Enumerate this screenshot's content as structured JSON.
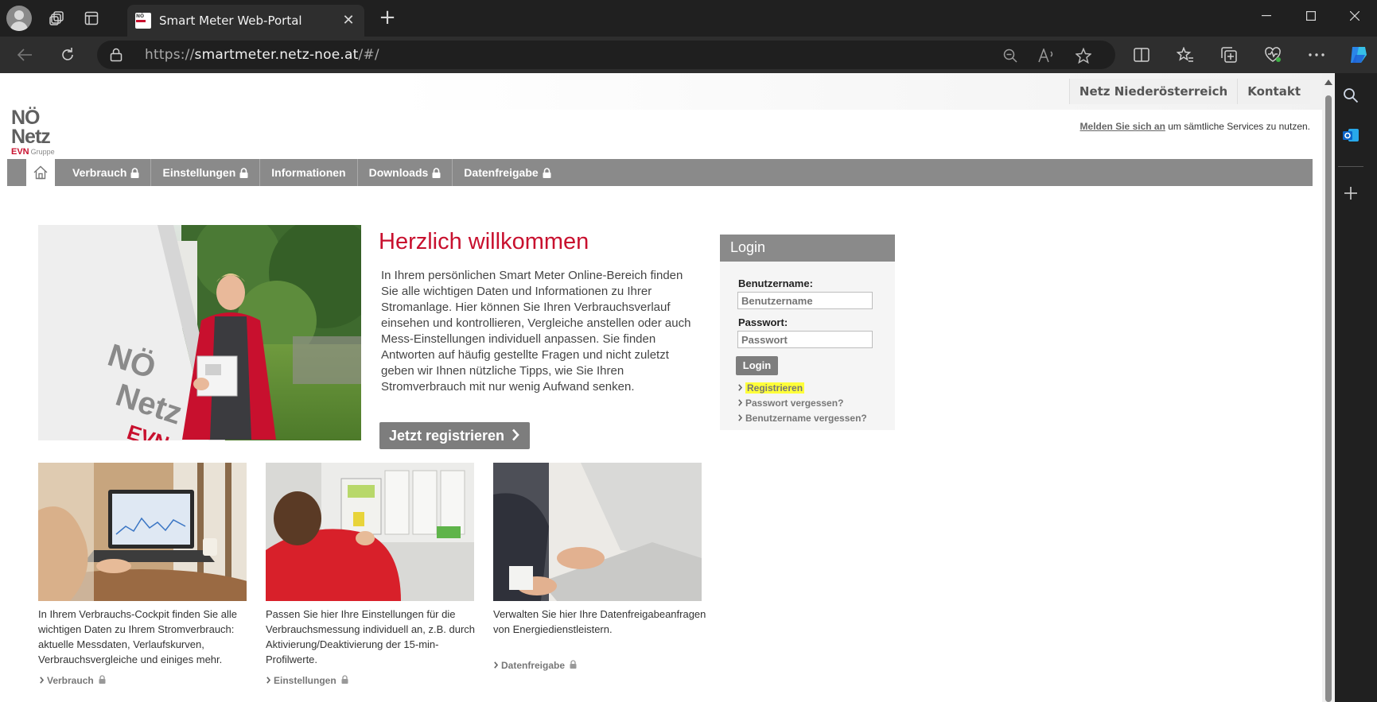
{
  "browser": {
    "tab_title": "Smart Meter Web-Portal",
    "favicon_text": "NÖ Netz",
    "url_scheme": "https://",
    "url_host": "smartmeter.netz-noe.at",
    "url_path": "/#/",
    "new_tab_label": "+",
    "close_tab_label": "✕"
  },
  "header": {
    "top_links": [
      "Netz Niederösterreich",
      "Kontakt"
    ],
    "logo": {
      "line1": "NÖ",
      "line2": "Netz",
      "brand": "EVN",
      "brand_suffix": "Gruppe"
    },
    "login_note_link": "Melden Sie sich an",
    "login_note_text": " um sämtliche Services zu nutzen."
  },
  "nav": {
    "items": [
      {
        "label": "Verbrauch",
        "locked": true
      },
      {
        "label": "Einstellungen",
        "locked": true
      },
      {
        "label": "Informationen",
        "locked": false
      },
      {
        "label": "Downloads",
        "locked": true
      },
      {
        "label": "Datenfreigabe",
        "locked": true
      }
    ]
  },
  "welcome": {
    "title": "Herzlich willkommen",
    "text": "In Ihrem persönlichen Smart Meter Online-Bereich finden Sie alle wichtigen Daten und Informationen zu Ihrer Stromanlage. Hier können Sie Ihren Verbrauchsverlauf einsehen und kontrollieren, Vergleiche anstellen oder auch Mess-Einstellungen individuell anpassen. Sie finden Antworten auf häufig gestellte Fragen und nicht zuletzt geben wir Ihnen nützliche Tipps, wie Sie Ihren Stromverbrauch mit nur wenig Aufwand senken.",
    "register_button": "Jetzt registrieren"
  },
  "login": {
    "title": "Login",
    "username_label": "Benutzername",
    "username_placeholder": "Benutzername",
    "password_label": "Passwort",
    "password_placeholder": "Passwort",
    "button": "Login",
    "links": [
      "Registrieren",
      "Passwort vergessen?",
      "Benutzername vergessen?"
    ]
  },
  "cards": [
    {
      "text": "In Ihrem Verbrauchs-Cockpit finden Sie alle wichtigen Daten zu Ihrem Stromverbrauch: aktuelle Messdaten, Verlaufskurven, Verbrauchsvergleiche und einiges mehr.",
      "link": "Verbrauch"
    },
    {
      "text": "Passen Sie hier Ihre Einstellungen für die Verbrauchsmessung individuell an, z.B. durch Aktivierung/Deaktivierung der 15-min-Profilwerte.",
      "link": "Einstellungen"
    },
    {
      "text": "Verwalten Sie hier Ihre Datenfreigabeanfragen von Energiedienstleistern.",
      "link": "Datenfreigabe"
    }
  ],
  "colors": {
    "brand_red": "#c8102e",
    "nav_gray": "#8a8a8a",
    "highlight": "#ffff3a"
  }
}
